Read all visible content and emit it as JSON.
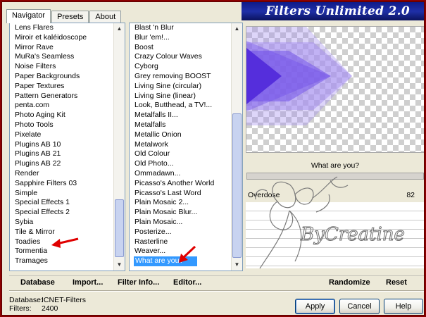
{
  "window": {
    "title": "Filters Unlimited 2.0"
  },
  "tabs": [
    {
      "label": "Navigator",
      "active": true
    },
    {
      "label": "Presets",
      "active": false
    },
    {
      "label": "About",
      "active": false
    }
  ],
  "categories": [
    "Lens Flares",
    "Miroir et kaléidoscope",
    "Mirror Rave",
    "MuRa's Seamless",
    "Noise Filters",
    "Paper Backgrounds",
    "Paper Textures",
    "Pattern Generators",
    "penta.com",
    "Photo Aging Kit",
    "Photo Tools",
    "Pixelate",
    "Plugins AB 10",
    "Plugins AB 21",
    "Plugins AB 22",
    "Render",
    "Sapphire Filters 03",
    "Simple",
    "Special Effects 1",
    "Special Effects 2",
    "Sybia",
    "Tile & Mirror",
    "Toadies",
    "Tormentia",
    "Tramages"
  ],
  "filters": [
    "Blast 'n Blur",
    "Blur 'em!...",
    "Boost",
    "Crazy Colour Waves",
    "Cyborg",
    "Grey removing BOOST",
    "Living Sine (circular)",
    "Living Sine (linear)",
    "Look, Butthead, a TV!...",
    "Metalfalls II...",
    "Metalfalls",
    "Metallic Onion",
    "Metalwork",
    "Old Colour",
    "Old Photo...",
    "Ommadawn...",
    "Picasso's Another World",
    "Picasso's Last Word",
    "Plain Mosaic 2...",
    "Plain Mosaic Blur...",
    "Plain Mosaic...",
    "Posterize...",
    "Rasterline",
    "Weaver...",
    "What are you?"
  ],
  "selected_filter_index": 24,
  "preview": {
    "filter_name": "What are you?"
  },
  "params": [
    {
      "label": "Overdose",
      "value": "82"
    }
  ],
  "toolbar": {
    "database": "Database",
    "import": "Import...",
    "filter_info": "Filter Info...",
    "editor": "Editor...",
    "randomize": "Randomize",
    "reset": "Reset"
  },
  "info": {
    "database_label": "Database:",
    "database_value": "ICNET-Filters",
    "filters_label": "Filters:",
    "filters_value": "2400"
  },
  "buttons": {
    "apply": "Apply",
    "cancel": "Cancel",
    "help": "Help"
  },
  "watermark": {
    "text": "ByCreatine"
  },
  "colors": {
    "title_bar": "#1f2fa8",
    "selection": "#3399ff",
    "arrow": "#e00000",
    "preview_purple": "#5a2de0"
  }
}
